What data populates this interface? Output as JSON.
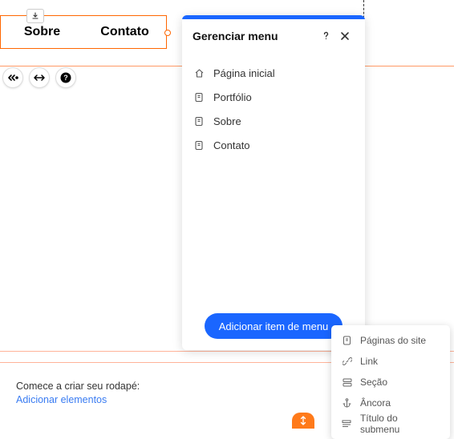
{
  "nav": {
    "items": [
      "Sobre",
      "Contato"
    ]
  },
  "panel": {
    "title": "Gerenciar menu",
    "items": [
      {
        "icon": "home",
        "label": "Página inicial"
      },
      {
        "icon": "page",
        "label": "Portfólio"
      },
      {
        "icon": "page",
        "label": "Sobre"
      },
      {
        "icon": "page",
        "label": "Contato"
      }
    ],
    "add_button": "Adicionar item de menu"
  },
  "flyout": {
    "items": [
      {
        "icon": "page",
        "label": "Páginas do site"
      },
      {
        "icon": "link",
        "label": "Link"
      },
      {
        "icon": "section",
        "label": "Seção"
      },
      {
        "icon": "anchor",
        "label": "Âncora"
      },
      {
        "icon": "subtitle",
        "label": "Título do submenu"
      }
    ]
  },
  "footer": {
    "prompt": "Comece a criar seu rodapé:",
    "link": "Adicionar elementos"
  },
  "colors": {
    "primary": "#1a66ff",
    "accent": "#ff6600"
  }
}
